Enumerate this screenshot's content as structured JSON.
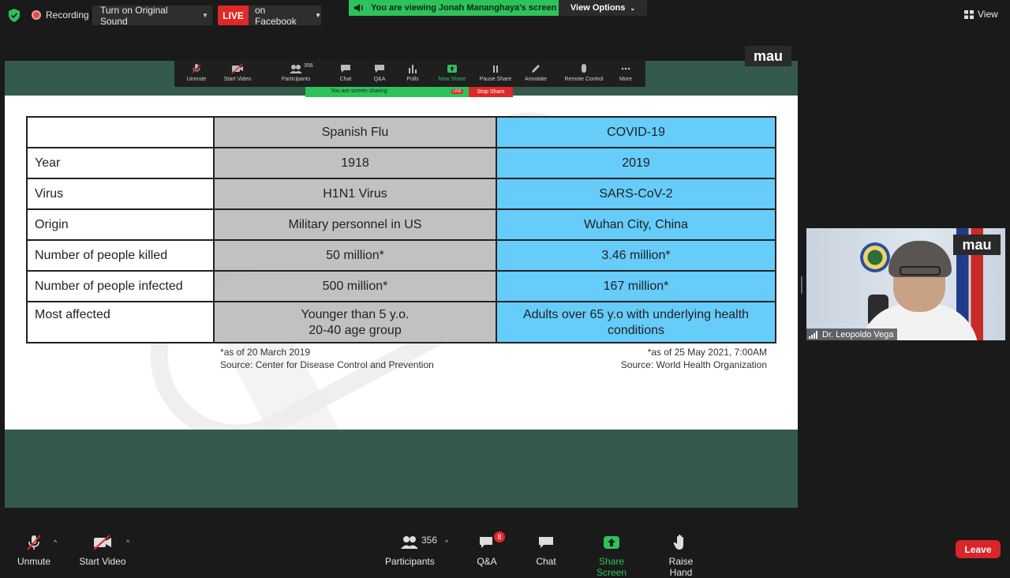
{
  "topbar": {
    "recording_label": "Recording",
    "sound_button": "Turn on Original Sound",
    "live_badge": "LIVE",
    "live_target": "on Facebook",
    "viewing_text": "You are viewing Jonah Mananghaya's screen",
    "view_options": "View Options",
    "view_label": "View"
  },
  "presenter_toolbar": {
    "items": [
      "Unmute",
      "Start Video",
      "Participants",
      "Chat",
      "Q&A",
      "Polls",
      "New Share",
      "Pause Share",
      "Annotate",
      "Remote Control",
      "More"
    ],
    "participants_count": "356",
    "sharing_text": "You are screen sharing",
    "live_mini": "LIVE",
    "stop_share": "Stop Share"
  },
  "share_label": "mau",
  "slide": {
    "headers": [
      "",
      "Spanish Flu",
      "COVID-19"
    ],
    "rows": [
      {
        "label": "Year",
        "flu": "1918",
        "covid": "2019"
      },
      {
        "label": "Virus",
        "flu": "H1N1 Virus",
        "covid": "SARS-CoV-2"
      },
      {
        "label": "Origin",
        "flu": "Military personnel in US",
        "covid": "Wuhan City, China"
      },
      {
        "label": "Number of people killed",
        "flu": "50 million*",
        "covid": "3.46 million*"
      },
      {
        "label": "Number of people infected",
        "flu": "500 million*",
        "covid": "167 million*"
      },
      {
        "label": "Most affected",
        "flu_line1": "Younger than 5 y.o.",
        "flu_line2": "20-40 age group",
        "covid_line1": "Adults over 65 y.o with underlying health",
        "covid_line2": "conditions"
      }
    ],
    "footnote_left_1": "*as of 20 March 2019",
    "footnote_left_2": "Source: Center for Disease Control and Prevention",
    "footnote_right_1": "*as of 25 May 2021, 7:00AM",
    "footnote_right_2": "Source: World Health Organization"
  },
  "video": {
    "label": "mau",
    "name": "Dr. Leopoldo Vega"
  },
  "bottom": {
    "unmute": "Unmute",
    "start_video": "Start Video",
    "participants_count": "356",
    "participants": "Participants",
    "qa": "Q&A",
    "qa_badge": "8",
    "chat": "Chat",
    "share_screen": "Share Screen",
    "raise_hand": "Raise Hand",
    "leave": "Leave"
  },
  "colors": {
    "accent_green": "#2ec25b",
    "live_red": "#e02828",
    "slide_frame": "#335a4a",
    "flu_column": "#bebebe",
    "covid_column": "#66ccfa"
  }
}
